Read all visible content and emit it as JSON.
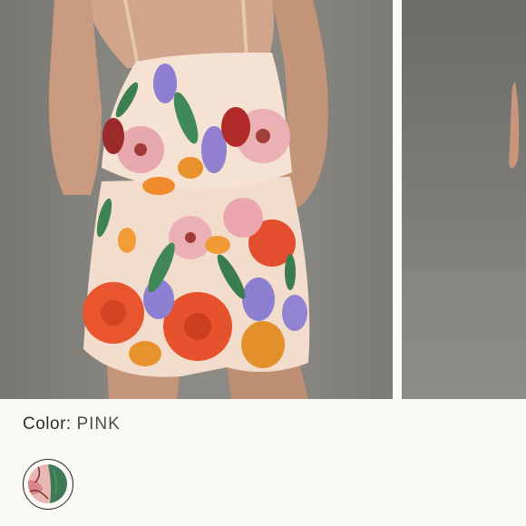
{
  "product": {
    "color_label": "Color:",
    "color_value": "PINK"
  },
  "gallery": {
    "main_image": "model-back-view-floral-romper",
    "next_image": "model-partial-view"
  },
  "swatches": [
    {
      "name": "pink-floral",
      "selected": true
    }
  ]
}
